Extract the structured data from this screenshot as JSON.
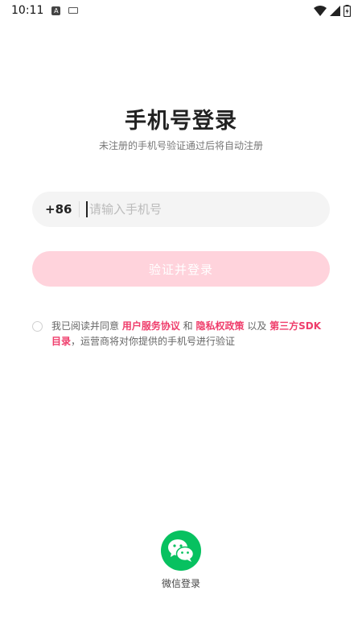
{
  "status_bar": {
    "time": "10:11"
  },
  "header": {
    "title": "手机号登录",
    "subtitle": "未注册的手机号验证通过后将自动注册"
  },
  "phone": {
    "country_code": "+86",
    "placeholder": "请输入手机号",
    "value": ""
  },
  "login_button": {
    "label": "验证并登录"
  },
  "agreement": {
    "prefix": "我已阅读并同意 ",
    "link_user_agreement": "用户服务协议",
    "and": " 和 ",
    "link_privacy": "隐私权政策",
    "and2": " 以及 ",
    "link_sdk": "第三方SDK目录",
    "suffix": "，运营商将对你提供的手机号进行验证"
  },
  "wechat_login": {
    "label": "微信登录"
  },
  "colors": {
    "accent": "#ef3d6b",
    "button_disabled": "#ffd3dc",
    "wechat_green": "#07c160"
  }
}
